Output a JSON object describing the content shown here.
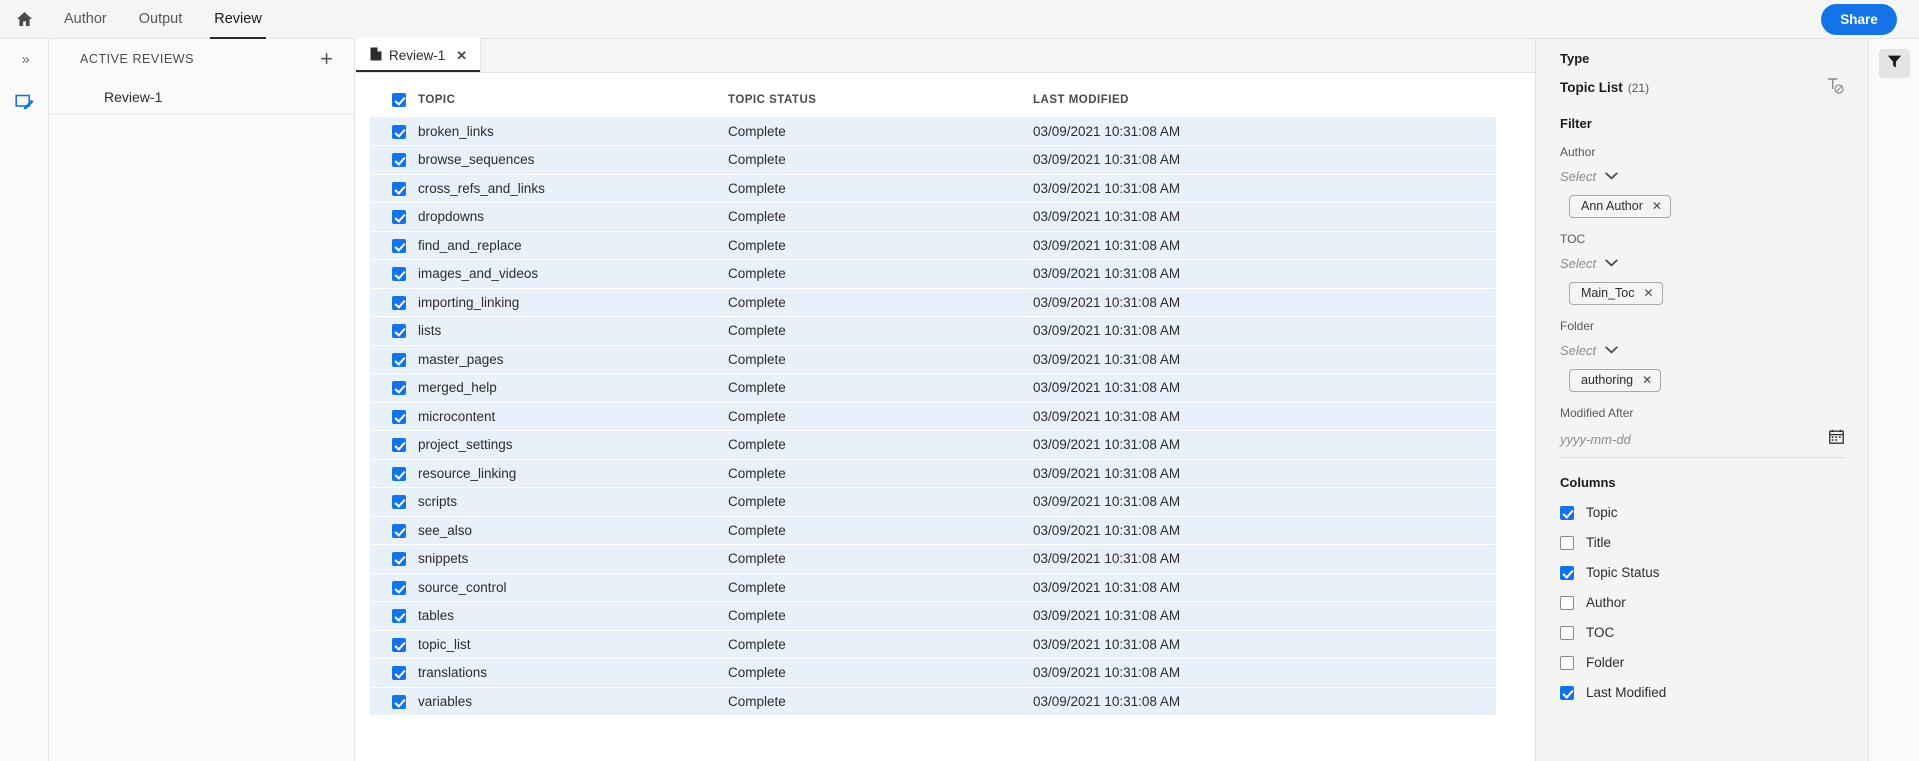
{
  "topbar": {
    "home_icon": "home-icon",
    "tabs": [
      {
        "label": "Author",
        "active": false
      },
      {
        "label": "Output",
        "active": false
      },
      {
        "label": "Review",
        "active": true
      }
    ],
    "share_label": "Share"
  },
  "rail": {
    "expand_icon": "double-chevron-right-icon",
    "review_icon": "review-edit-icon"
  },
  "left_panel": {
    "title": "ACTIVE REVIEWS",
    "add_label": "+",
    "items": [
      {
        "label": "Review-1"
      }
    ]
  },
  "center": {
    "doc_tab": {
      "label": "Review-1",
      "close_label": "✕",
      "file_icon": "file-document-icon"
    },
    "table": {
      "headers": {
        "topic": "TOPIC",
        "topic_status": "TOPIC STATUS",
        "last_modified": "LAST MODIFIED"
      },
      "select_all_checked": true,
      "rows": [
        {
          "checked": true,
          "topic": "broken_links",
          "status": "Complete",
          "modified": "03/09/2021 10:31:08 AM"
        },
        {
          "checked": true,
          "topic": "browse_sequences",
          "status": "Complete",
          "modified": "03/09/2021 10:31:08 AM"
        },
        {
          "checked": true,
          "topic": "cross_refs_and_links",
          "status": "Complete",
          "modified": "03/09/2021 10:31:08 AM"
        },
        {
          "checked": true,
          "topic": "dropdowns",
          "status": "Complete",
          "modified": "03/09/2021 10:31:08 AM"
        },
        {
          "checked": true,
          "topic": "find_and_replace",
          "status": "Complete",
          "modified": "03/09/2021 10:31:08 AM"
        },
        {
          "checked": true,
          "topic": "images_and_videos",
          "status": "Complete",
          "modified": "03/09/2021 10:31:08 AM"
        },
        {
          "checked": true,
          "topic": "importing_linking",
          "status": "Complete",
          "modified": "03/09/2021 10:31:08 AM"
        },
        {
          "checked": true,
          "topic": "lists",
          "status": "Complete",
          "modified": "03/09/2021 10:31:08 AM"
        },
        {
          "checked": true,
          "topic": "master_pages",
          "status": "Complete",
          "modified": "03/09/2021 10:31:08 AM"
        },
        {
          "checked": true,
          "topic": "merged_help",
          "status": "Complete",
          "modified": "03/09/2021 10:31:08 AM"
        },
        {
          "checked": true,
          "topic": "microcontent",
          "status": "Complete",
          "modified": "03/09/2021 10:31:08 AM"
        },
        {
          "checked": true,
          "topic": "project_settings",
          "status": "Complete",
          "modified": "03/09/2021 10:31:08 AM"
        },
        {
          "checked": true,
          "topic": "resource_linking",
          "status": "Complete",
          "modified": "03/09/2021 10:31:08 AM"
        },
        {
          "checked": true,
          "topic": "scripts",
          "status": "Complete",
          "modified": "03/09/2021 10:31:08 AM"
        },
        {
          "checked": true,
          "topic": "see_also",
          "status": "Complete",
          "modified": "03/09/2021 10:31:08 AM"
        },
        {
          "checked": true,
          "topic": "snippets",
          "status": "Complete",
          "modified": "03/09/2021 10:31:08 AM"
        },
        {
          "checked": true,
          "topic": "source_control",
          "status": "Complete",
          "modified": "03/09/2021 10:31:08 AM"
        },
        {
          "checked": true,
          "topic": "tables",
          "status": "Complete",
          "modified": "03/09/2021 10:31:08 AM"
        },
        {
          "checked": true,
          "topic": "topic_list",
          "status": "Complete",
          "modified": "03/09/2021 10:31:08 AM"
        },
        {
          "checked": true,
          "topic": "translations",
          "status": "Complete",
          "modified": "03/09/2021 10:31:08 AM"
        },
        {
          "checked": true,
          "topic": "variables",
          "status": "Complete",
          "modified": "03/09/2021 10:31:08 AM"
        }
      ]
    }
  },
  "right_panel": {
    "type_label": "Type",
    "type_value": "Topic List",
    "type_count": "(21)",
    "clear_text_icon": "clear-text-formatting-icon",
    "filter_title": "Filter",
    "fields": [
      {
        "label": "Author",
        "select_placeholder": "Select",
        "chips": [
          {
            "label": "Ann Author",
            "remove": "✕"
          }
        ]
      },
      {
        "label": "TOC",
        "select_placeholder": "Select",
        "chips": [
          {
            "label": "Main_Toc",
            "remove": "✕"
          }
        ]
      },
      {
        "label": "Folder",
        "select_placeholder": "Select",
        "chips": [
          {
            "label": "authoring",
            "remove": "✕"
          }
        ]
      }
    ],
    "modified_after_label": "Modified After",
    "modified_after_placeholder": "yyyy-mm-dd",
    "modified_after_value": "",
    "calendar_icon": "calendar-icon",
    "columns_title": "Columns",
    "columns": [
      {
        "label": "Topic",
        "checked": true
      },
      {
        "label": "Title",
        "checked": false
      },
      {
        "label": "Topic Status",
        "checked": true
      },
      {
        "label": "Author",
        "checked": false
      },
      {
        "label": "TOC",
        "checked": false
      },
      {
        "label": "Folder",
        "checked": false
      },
      {
        "label": "Last Modified",
        "checked": true
      }
    ]
  },
  "filter_rail": {
    "filter_icon": "funnel-filter-icon"
  },
  "colors": {
    "accent": "#1473e6",
    "row_selected": "#e8f0fa",
    "panel_bg": "#f4f4f4",
    "topbar_bg": "#f5f5f5"
  }
}
